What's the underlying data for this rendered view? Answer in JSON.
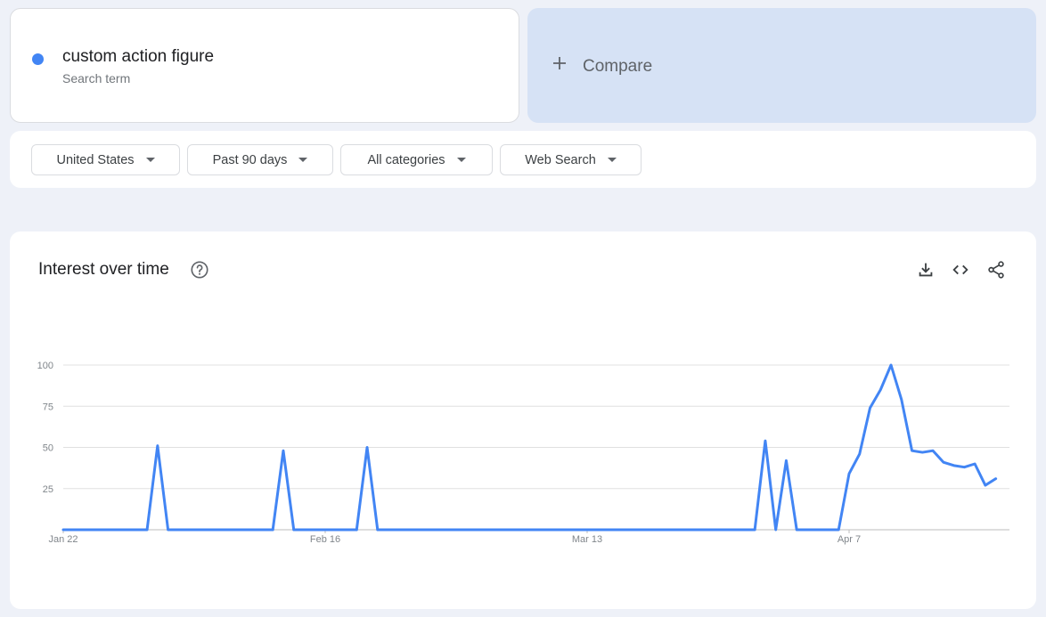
{
  "search_term": {
    "name": "custom action figure",
    "subtitle": "Search term",
    "color": "#4285f4"
  },
  "compare": {
    "label": "Compare"
  },
  "filters": [
    {
      "label": "United States"
    },
    {
      "label": "Past 90 days"
    },
    {
      "label": "All categories"
    },
    {
      "label": "Web Search"
    }
  ],
  "chart_panel": {
    "title": "Interest over time",
    "icons": [
      "help-icon",
      "download-icon",
      "embed-icon",
      "share-icon"
    ]
  },
  "chart_data": {
    "type": "line",
    "title": "Interest over time",
    "xlabel": "",
    "ylabel": "",
    "ylim": [
      0,
      100
    ],
    "y_ticks": [
      25,
      50,
      75,
      100
    ],
    "x_tick_labels": [
      {
        "label": "Jan 22",
        "index": 0
      },
      {
        "label": "Feb 16",
        "index": 25
      },
      {
        "label": "Mar 13",
        "index": 50
      },
      {
        "label": "Apr 7",
        "index": 75
      }
    ],
    "grid": true,
    "line_color": "#4285f4",
    "series": [
      {
        "values": [
          0,
          0,
          0,
          0,
          0,
          0,
          0,
          0,
          0,
          51,
          0,
          0,
          0,
          0,
          0,
          0,
          0,
          0,
          0,
          0,
          0,
          48,
          0,
          0,
          0,
          0,
          0,
          0,
          0,
          50,
          0,
          0,
          0,
          0,
          0,
          0,
          0,
          0,
          0,
          0,
          0,
          0,
          0,
          0,
          0,
          0,
          0,
          0,
          0,
          0,
          0,
          0,
          0,
          0,
          0,
          0,
          0,
          0,
          0,
          0,
          0,
          0,
          0,
          0,
          0,
          0,
          0,
          54,
          0,
          42,
          0,
          0,
          0,
          0,
          0,
          34,
          46,
          74,
          85,
          100,
          79,
          48,
          47,
          48,
          41,
          39,
          38,
          40,
          27,
          31
        ]
      }
    ]
  }
}
